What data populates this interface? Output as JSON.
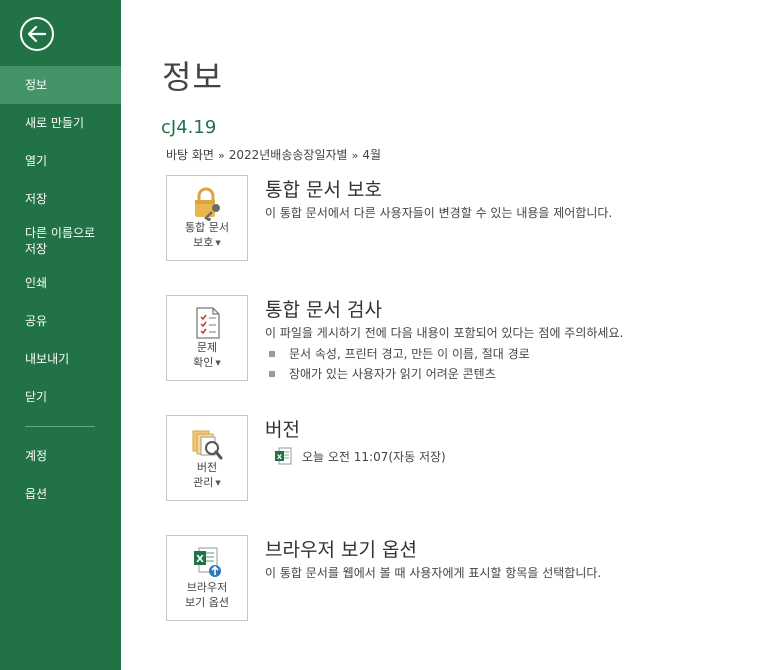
{
  "sidebar": {
    "back_label": "back",
    "items": [
      {
        "label": "정보",
        "active": true
      },
      {
        "label": "새로 만들기"
      },
      {
        "label": "열기"
      },
      {
        "label": "저장"
      },
      {
        "label": "다른 이름으로\n저장"
      },
      {
        "label": "인쇄"
      },
      {
        "label": "공유"
      },
      {
        "label": "내보내기"
      },
      {
        "label": "닫기"
      }
    ],
    "bottom_items": [
      {
        "label": "계정"
      },
      {
        "label": "옵션"
      }
    ]
  },
  "main": {
    "title": "정보",
    "file_name": "cJ4.19",
    "breadcrumb": [
      "바탕 화면",
      "2022년배송송장일자별",
      "4월"
    ],
    "breadcrumb_sep": "»",
    "sections": [
      {
        "button_label_line1": "통합 문서",
        "button_label_line2": "보호",
        "title": "통합 문서 보호",
        "description": "이 통합 문서에서 다른 사용자들이 변경할 수 있는 내용을 제어합니다.",
        "icon": "lock-icon"
      },
      {
        "button_label_line1": "문제",
        "button_label_line2": "확인",
        "title": "통합 문서 검사",
        "description": "이 파일을 게시하기 전에 다음 내용이 포함되어 있다는 점에 주의하세요.",
        "bullets": [
          "문서 속성, 프린터 경고, 만든 이 이름, 절대 경로",
          "장애가 있는 사용자가 읽기 어려운 콘텐츠"
        ],
        "icon": "inspect-document-icon"
      },
      {
        "button_label_line1": "버전",
        "button_label_line2": "관리",
        "title": "버전",
        "version_entry": "오늘 오전 11:07(자동 저장)",
        "icon": "manage-versions-icon"
      },
      {
        "button_label_line1": "브라우저",
        "button_label_line2": "보기 옵션",
        "title": "브라우저 보기 옵션",
        "description": "이 통합 문서를 웹에서 볼 때 사용자에게 표시할 항목을 선택합니다.",
        "icon": "browser-view-icon"
      }
    ]
  },
  "colors": {
    "sidebar_bg": "#217346",
    "sidebar_active": "#439467",
    "file_name": "#217346"
  }
}
